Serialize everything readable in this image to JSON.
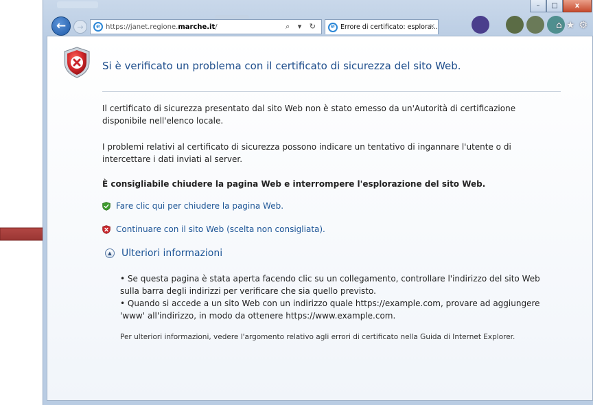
{
  "browser": {
    "address": {
      "prefix": "https://janet.regione.",
      "domain": "marche.it",
      "suffix": "/"
    },
    "address_tools": "⌕ ▾ ↻",
    "tab_title": "Errore di certificato: esplora...",
    "tab_close": "×",
    "window_buttons": {
      "minimize": "–",
      "maximize": "□",
      "close": "x"
    },
    "toolbar_icons": [
      "home-icon",
      "star-icon",
      "gear-icon"
    ]
  },
  "page": {
    "title": "Si è verificato un problema con il certificato di sicurezza del sito Web.",
    "paragraph1": "Il certificato di sicurezza presentato dal sito Web non è stato emesso da un'Autorità di certificazione disponibile nell'elenco locale.",
    "paragraph2": "I problemi relativi al certificato di sicurezza possono indicare un tentativo di ingannare l'utente o di intercettare i dati inviati al server.",
    "advice": "È consigliabile chiudere la pagina Web e interrompere l'esplorazione del sito Web.",
    "close_link": "Fare clic qui per chiudere la pagina Web.",
    "continue_link": "Continuare con il sito Web (scelta non consigliata).",
    "more_info": "Ulteriori informazioni",
    "bullet1": "•   Se questa pagina è stata aperta facendo clic su un collegamento, controllare l'indirizzo del sito Web sulla barra degli indirizzi per verificare che sia quello previsto.",
    "bullet2": "•   Quando si accede a un sito Web con un indirizzo quale https://example.com, provare ad aggiungere 'www' all'indirizzo, in modo da ottenere https://www.example.com.",
    "footer": "Per ulteriori informazioni, vedere l'argomento relativo agli errori di certificato nella Guida di Internet Explorer."
  },
  "colors": {
    "link": "#1d5596",
    "title": "#1f4e8c",
    "arrow": "#a33a36",
    "shield_red": "#c8262b",
    "shield_green": "#3e9a2e"
  }
}
